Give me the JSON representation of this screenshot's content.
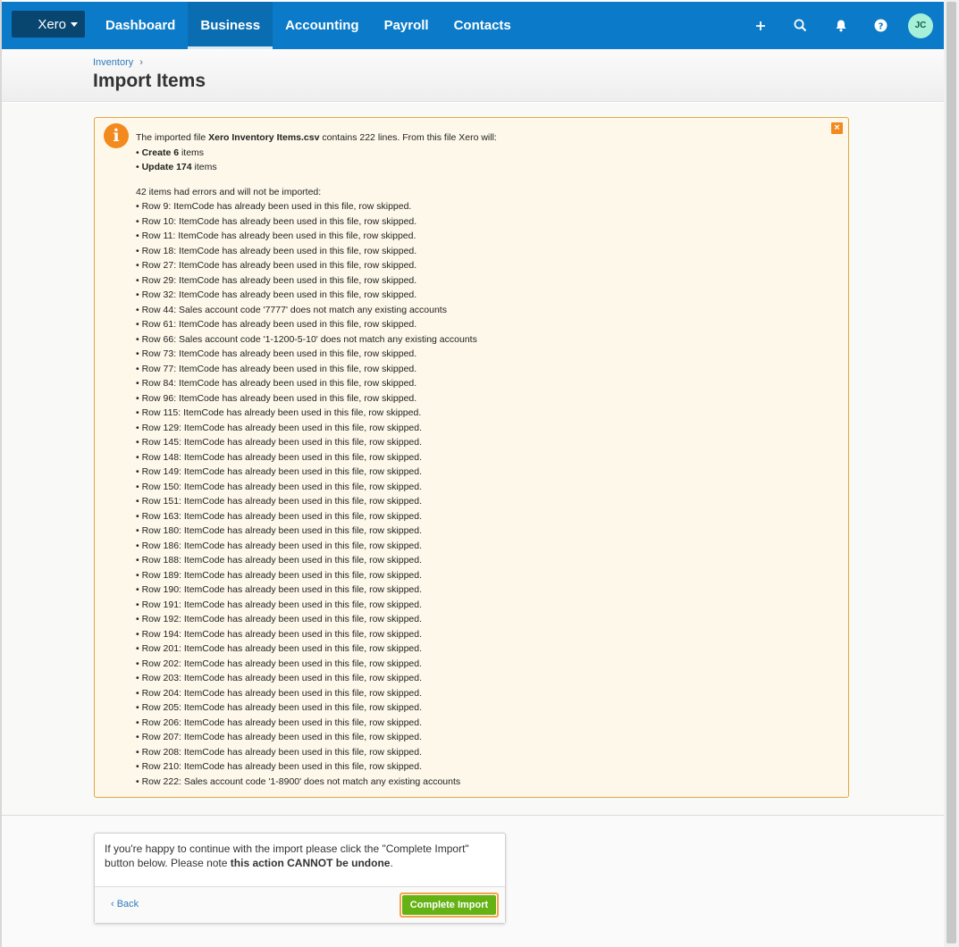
{
  "nav": {
    "org_label": "Xero",
    "tabs": [
      {
        "label": "Dashboard",
        "active": false
      },
      {
        "label": "Business",
        "active": true
      },
      {
        "label": "Accounting",
        "active": false
      },
      {
        "label": "Payroll",
        "active": false
      },
      {
        "label": "Contacts",
        "active": false
      }
    ],
    "avatar_initials": "JC",
    "icons": [
      "plus-icon",
      "search-icon",
      "bell-icon",
      "help-icon"
    ]
  },
  "header": {
    "breadcrumb": "Inventory",
    "breadcrumb_separator": "›",
    "title": "Import Items"
  },
  "notice": {
    "intro_prefix": "The imported file ",
    "file_name": "Xero Inventory Items.csv",
    "intro_suffix": " contains 222 lines. From this file Xero will:",
    "create_bold": "Create 6",
    "create_rest": " items",
    "update_bold": "Update 174",
    "update_rest": " items",
    "error_heading": "42 items had errors and will not be imported:",
    "errors": [
      "• Row 9: ItemCode has already been used in this file, row skipped.",
      "• Row 10: ItemCode has already been used in this file, row skipped.",
      "• Row 11: ItemCode has already been used in this file, row skipped.",
      "• Row 18: ItemCode has already been used in this file, row skipped.",
      "• Row 27: ItemCode has already been used in this file, row skipped.",
      "• Row 29: ItemCode has already been used in this file, row skipped.",
      "• Row 32: ItemCode has already been used in this file, row skipped.",
      "• Row 44: Sales account code '7777' does not match any existing accounts",
      "• Row 61: ItemCode has already been used in this file, row skipped.",
      "• Row 66: Sales account code '1-1200-5-10' does not match any existing accounts",
      "• Row 73: ItemCode has already been used in this file, row skipped.",
      "• Row 77: ItemCode has already been used in this file, row skipped.",
      "• Row 84: ItemCode has already been used in this file, row skipped.",
      "• Row 96: ItemCode has already been used in this file, row skipped.",
      "• Row 115: ItemCode has already been used in this file, row skipped.",
      "• Row 129: ItemCode has already been used in this file, row skipped.",
      "• Row 145: ItemCode has already been used in this file, row skipped.",
      "• Row 148: ItemCode has already been used in this file, row skipped.",
      "• Row 149: ItemCode has already been used in this file, row skipped.",
      "• Row 150: ItemCode has already been used in this file, row skipped.",
      "• Row 151: ItemCode has already been used in this file, row skipped.",
      "• Row 163: ItemCode has already been used in this file, row skipped.",
      "• Row 180: ItemCode has already been used in this file, row skipped.",
      "• Row 186: ItemCode has already been used in this file, row skipped.",
      "• Row 188: ItemCode has already been used in this file, row skipped.",
      "• Row 189: ItemCode has already been used in this file, row skipped.",
      "• Row 190: ItemCode has already been used in this file, row skipped.",
      "• Row 191: ItemCode has already been used in this file, row skipped.",
      "• Row 192: ItemCode has already been used in this file, row skipped.",
      "• Row 194: ItemCode has already been used in this file, row skipped.",
      "• Row 201: ItemCode has already been used in this file, row skipped.",
      "• Row 202: ItemCode has already been used in this file, row skipped.",
      "• Row 203: ItemCode has already been used in this file, row skipped.",
      "• Row 204: ItemCode has already been used in this file, row skipped.",
      "• Row 205: ItemCode has already been used in this file, row skipped.",
      "• Row 206: ItemCode has already been used in this file, row skipped.",
      "• Row 207: ItemCode has already been used in this file, row skipped.",
      "• Row 208: ItemCode has already been used in this file, row skipped.",
      "• Row 210: ItemCode has already been used in this file, row skipped.",
      "• Row 222: Sales account code '1-8900' does not match any existing accounts"
    ]
  },
  "confirm": {
    "text_prefix": "If you're happy to continue with the import please click the \"Complete Import\" button below. Please note ",
    "text_bold": "this action CANNOT be undone",
    "text_suffix": ".",
    "back_label": "‹ Back",
    "complete_label": "Complete Import"
  },
  "colors": {
    "nav_bg": "#0b7ac8",
    "notice_border": "#e3a740",
    "notice_bg": "#fdf8ea",
    "info_orange": "#f28a1e",
    "button_green": "#64b214"
  }
}
